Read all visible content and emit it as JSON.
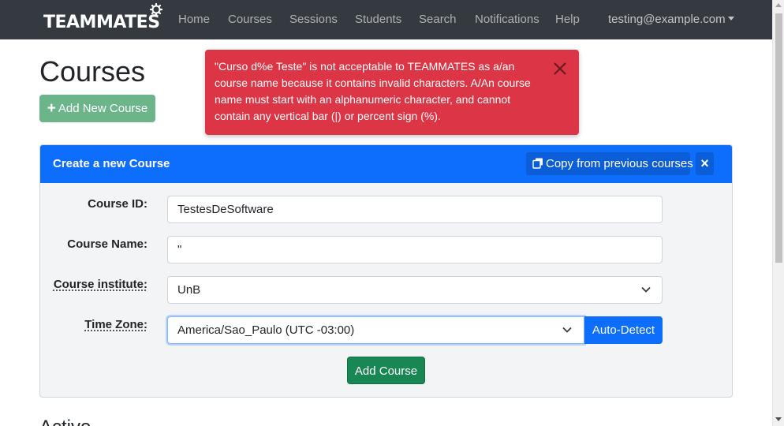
{
  "navbar": {
    "brand": "TEAMMATES",
    "items": [
      {
        "label": "Home"
      },
      {
        "label": "Courses"
      },
      {
        "label": "Sessions"
      },
      {
        "label": "Students"
      },
      {
        "label": "Search"
      },
      {
        "label": "Notifications"
      },
      {
        "label": "Help"
      }
    ],
    "user": "testing@example.com"
  },
  "page": {
    "title": "Courses",
    "add_new_course_label": "Add New Course",
    "next_section_heading": "Active"
  },
  "alert": {
    "message": "\"Curso d%e Teste\" is not acceptable to TEAMMATES as a/an course name because it contains invalid characters. A/An course name must start with an alphanumeric character, and cannot contain any vertical bar (|) or percent sign (%).",
    "color": "#dc3545"
  },
  "create_course": {
    "title": "Create a new Course",
    "copy_button_label": "Copy from previous courses",
    "close_label": "×",
    "fields": {
      "course_id": {
        "label": "Course ID:",
        "value": "TestesDeSoftware"
      },
      "course_name": {
        "label": "Course Name:",
        "value": "\""
      },
      "course_institute": {
        "label": "Course institute:",
        "value": "UnB"
      },
      "time_zone": {
        "label": "Time Zone:",
        "value": "America/Sao_Paulo (UTC -03:00)"
      }
    },
    "auto_detect_label": "Auto-Detect",
    "submit_label": "Add Course"
  },
  "colors": {
    "navbar": "#343a40",
    "primary": "#0d6efd",
    "success": "#198754",
    "danger": "#dc3545"
  },
  "icons": [
    "gear-icon",
    "plus-icon",
    "close-icon",
    "copy-icon",
    "chevron-down-icon",
    "caret-down-icon"
  ]
}
